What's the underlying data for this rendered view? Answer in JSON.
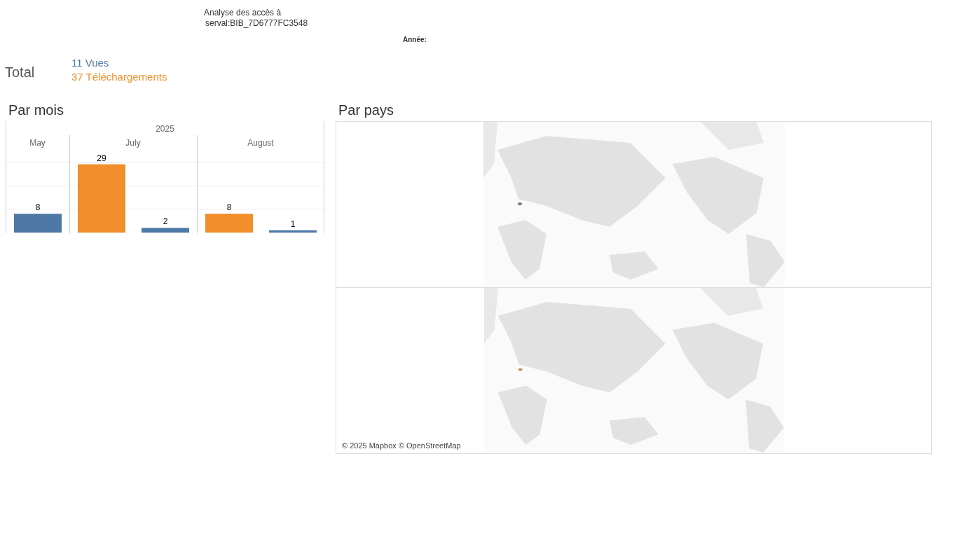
{
  "header": {
    "title_line1": "Analyse des accès à",
    "title_line2": "serval:BIB_7D6777FC3548",
    "year_label": "Année:"
  },
  "total": {
    "label": "Total",
    "views": "11 Vues",
    "downloads": "37 Téléchargements"
  },
  "by_month": {
    "title": "Par mois",
    "year": "2025",
    "chart_data": {
      "type": "bar",
      "categories": [
        "May",
        "July",
        "August"
      ],
      "series": [
        {
          "color": "#f28e2b",
          "values": [
            null,
            29,
            8
          ]
        },
        {
          "color": "#4e79a7",
          "values": [
            8,
            2,
            1
          ]
        }
      ],
      "data_labels": true
    }
  },
  "by_country": {
    "title": "Par pays",
    "attribution": "© 2025 Mapbox © OpenStreetMap"
  }
}
